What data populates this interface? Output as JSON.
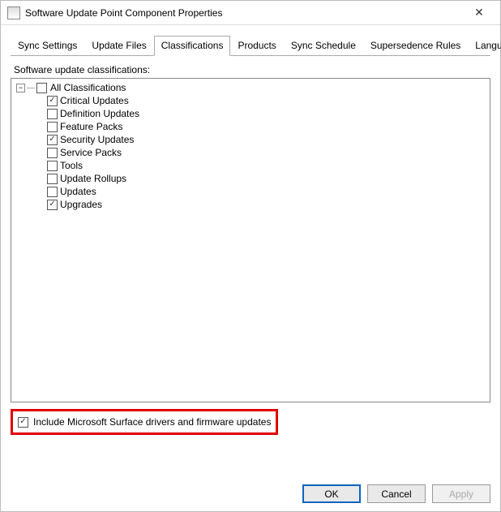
{
  "window": {
    "title": "Software Update Point Component Properties"
  },
  "tabs": [
    {
      "label": "Sync Settings"
    },
    {
      "label": "Update Files"
    },
    {
      "label": "Classifications"
    },
    {
      "label": "Products"
    },
    {
      "label": "Sync Schedule"
    },
    {
      "label": "Supersedence Rules"
    },
    {
      "label": "Languages"
    }
  ],
  "active_tab_index": 2,
  "classifications": {
    "section_label": "Software update classifications:",
    "root_label": "All Classifications",
    "root_checked": false,
    "items": [
      {
        "label": "Critical Updates",
        "checked": true
      },
      {
        "label": "Definition Updates",
        "checked": false
      },
      {
        "label": "Feature Packs",
        "checked": false
      },
      {
        "label": "Security Updates",
        "checked": true
      },
      {
        "label": "Service Packs",
        "checked": false
      },
      {
        "label": "Tools",
        "checked": false
      },
      {
        "label": "Update Rollups",
        "checked": false
      },
      {
        "label": "Updates",
        "checked": false
      },
      {
        "label": "Upgrades",
        "checked": true
      }
    ]
  },
  "surface_option": {
    "label": "Include Microsoft Surface drivers and firmware updates",
    "checked": true
  },
  "buttons": {
    "ok": "OK",
    "cancel": "Cancel",
    "apply": "Apply"
  }
}
